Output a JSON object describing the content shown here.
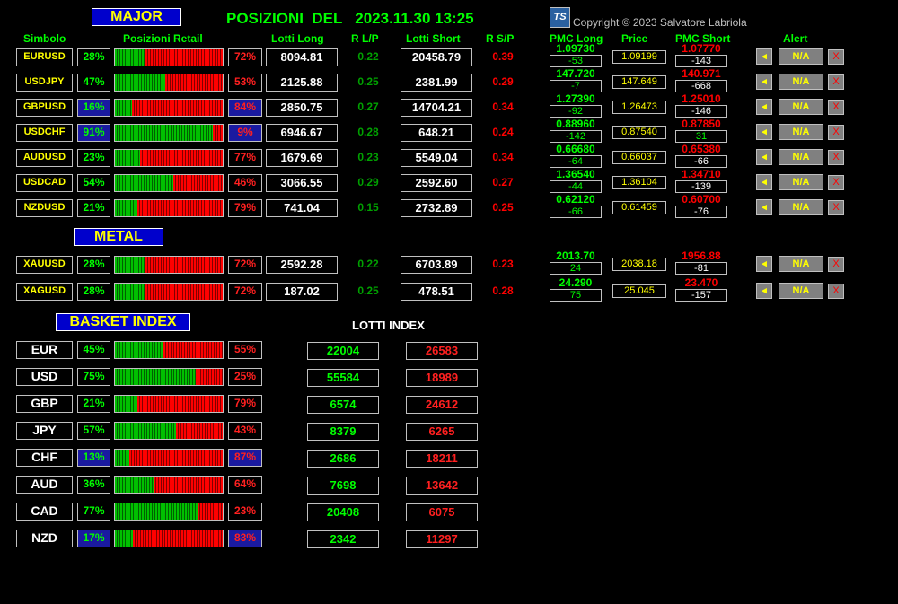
{
  "header": {
    "major_label": "MAJOR",
    "title": "POSIZIONI  DEL   2023.11.30 13:25",
    "copyright": "Copyright © 2023 Salvatore Labriola",
    "logo_text": "TS"
  },
  "columns": {
    "simbolo": "Simbolo",
    "posizioni": "Posizioni Retail",
    "lotti_long": "Lotti Long",
    "rlp": "R L/P",
    "lotti_short": "Lotti Short",
    "rsp": "R S/P",
    "pmc_long": "PMC Long",
    "price": "Price",
    "pmc_short": "PMC Short",
    "alert": "Alert"
  },
  "colors": {
    "long": "#00ff00",
    "short": "#ff0000",
    "label": "#ffff00",
    "title_bg": "#0000cc"
  },
  "major": [
    {
      "symbol": "EURUSD",
      "long_pct": "28%",
      "long_value": 0.28,
      "short_pct": "72%",
      "lotti_long": "8094.81",
      "rlp": "0.22",
      "lotti_short": "20458.79",
      "rsp": "0.39",
      "pmc_long": "1.09730",
      "pmc_long_diff": "-53",
      "price": "1.09199",
      "pmc_short": "1.07770",
      "pmc_short_diff": "-143",
      "alert": "N/A",
      "close": "X"
    },
    {
      "symbol": "USDJPY",
      "long_pct": "47%",
      "long_value": 0.47,
      "short_pct": "53%",
      "lotti_long": "2125.88",
      "rlp": "0.25",
      "lotti_short": "2381.99",
      "rsp": "0.29",
      "pmc_long": "147.720",
      "pmc_long_diff": "-7",
      "price": "147.649",
      "pmc_short": "140.971",
      "pmc_short_diff": "-668",
      "alert": "N/A",
      "close": "X"
    },
    {
      "symbol": "GBPUSD",
      "long_pct": "16%",
      "long_value": 0.16,
      "short_pct": "84%",
      "lotti_long": "2850.75",
      "rlp": "0.27",
      "lotti_short": "14704.21",
      "rsp": "0.34",
      "pmc_long": "1.27390",
      "pmc_long_diff": "-92",
      "price": "1.26473",
      "pmc_short": "1.25010",
      "pmc_short_diff": "-146",
      "alert": "N/A",
      "close": "X",
      "hl_left": true,
      "hl_right": true
    },
    {
      "symbol": "USDCHF",
      "long_pct": "91%",
      "long_value": 0.91,
      "short_pct": "9%",
      "lotti_long": "6946.67",
      "rlp": "0.28",
      "lotti_short": "648.21",
      "rsp": "0.24",
      "pmc_long": "0.88960",
      "pmc_long_diff": "-142",
      "price": "0.87540",
      "pmc_short": "0.87850",
      "pmc_short_diff": "31",
      "short_diff_green": true,
      "alert": "N/A",
      "close": "X",
      "hl_left": true,
      "hl_right": true
    },
    {
      "symbol": "AUDUSD",
      "long_pct": "23%",
      "long_value": 0.23,
      "short_pct": "77%",
      "lotti_long": "1679.69",
      "rlp": "0.23",
      "lotti_short": "5549.04",
      "rsp": "0.34",
      "pmc_long": "0.66680",
      "pmc_long_diff": "-64",
      "price": "0.66037",
      "pmc_short": "0.65380",
      "pmc_short_diff": "-66",
      "alert": "N/A",
      "close": "X"
    },
    {
      "symbol": "USDCAD",
      "long_pct": "54%",
      "long_value": 0.54,
      "short_pct": "46%",
      "lotti_long": "3066.55",
      "rlp": "0.29",
      "lotti_short": "2592.60",
      "rsp": "0.27",
      "pmc_long": "1.36540",
      "pmc_long_diff": "-44",
      "price": "1.36104",
      "pmc_short": "1.34710",
      "pmc_short_diff": "-139",
      "alert": "N/A",
      "close": "X"
    },
    {
      "symbol": "NZDUSD",
      "long_pct": "21%",
      "long_value": 0.21,
      "short_pct": "79%",
      "lotti_long": "741.04",
      "rlp": "0.15",
      "lotti_short": "2732.89",
      "rsp": "0.25",
      "pmc_long": "0.62120",
      "pmc_long_diff": "-66",
      "price": "0.61459",
      "pmc_short": "0.60700",
      "pmc_short_diff": "-76",
      "alert": "N/A",
      "close": "X"
    }
  ],
  "metal_label": "METAL",
  "metal": [
    {
      "symbol": "XAUUSD",
      "long_pct": "28%",
      "long_value": 0.28,
      "short_pct": "72%",
      "lotti_long": "2592.28",
      "rlp": "0.22",
      "lotti_short": "6703.89",
      "rsp": "0.23",
      "pmc_long": "2013.70",
      "pmc_long_diff": "24",
      "price": "2038.18",
      "pmc_short": "1956.88",
      "pmc_short_diff": "-81",
      "alert": "N/A",
      "close": "X"
    },
    {
      "symbol": "XAGUSD",
      "long_pct": "28%",
      "long_value": 0.28,
      "short_pct": "72%",
      "lotti_long": "187.02",
      "rlp": "0.25",
      "lotti_short": "478.51",
      "rsp": "0.28",
      "pmc_long": "24.290",
      "pmc_long_diff": "75",
      "price": "25.045",
      "pmc_short": "23.470",
      "pmc_short_diff": "-157",
      "alert": "N/A",
      "close": "X"
    }
  ],
  "basket_label": "BASKET INDEX",
  "lotti_index_label": "LOTTI INDEX",
  "basket": [
    {
      "symbol": "EUR",
      "long_pct": "45%",
      "long_value": 0.45,
      "short_pct": "55%",
      "lotti_long": "22004",
      "lotti_short": "26583"
    },
    {
      "symbol": "USD",
      "long_pct": "75%",
      "long_value": 0.75,
      "short_pct": "25%",
      "lotti_long": "55584",
      "lotti_short": "18989"
    },
    {
      "symbol": "GBP",
      "long_pct": "21%",
      "long_value": 0.21,
      "short_pct": "79%",
      "lotti_long": "6574",
      "lotti_short": "24612"
    },
    {
      "symbol": "JPY",
      "long_pct": "57%",
      "long_value": 0.57,
      "short_pct": "43%",
      "lotti_long": "8379",
      "lotti_short": "6265"
    },
    {
      "symbol": "CHF",
      "long_pct": "13%",
      "long_value": 0.13,
      "short_pct": "87%",
      "lotti_long": "2686",
      "lotti_short": "18211",
      "hl_left": true,
      "hl_right": true
    },
    {
      "symbol": "AUD",
      "long_pct": "36%",
      "long_value": 0.36,
      "short_pct": "64%",
      "lotti_long": "7698",
      "lotti_short": "13642"
    },
    {
      "symbol": "CAD",
      "long_pct": "77%",
      "long_value": 0.77,
      "short_pct": "23%",
      "lotti_long": "20408",
      "lotti_short": "6075"
    },
    {
      "symbol": "NZD",
      "long_pct": "17%",
      "long_value": 0.17,
      "short_pct": "83%",
      "lotti_long": "2342",
      "lotti_short": "11297",
      "hl_left": true,
      "hl_right": true
    }
  ]
}
